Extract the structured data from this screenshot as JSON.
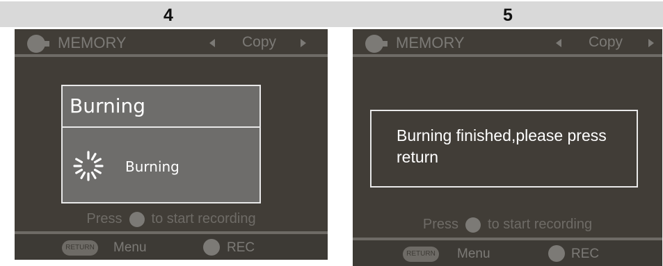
{
  "steps": {
    "left": "4",
    "right": "5"
  },
  "screen4": {
    "header": {
      "title": "MEMORY",
      "option": "Copy"
    },
    "dialog": {
      "title": "Burning",
      "status": "Burning"
    },
    "hint": {
      "press": "Press",
      "rest": "to start recording"
    },
    "footer": {
      "return_label": "RETURN",
      "menu": "Menu",
      "rec": "REC"
    }
  },
  "screen5": {
    "header": {
      "title": "MEMORY",
      "option": "Copy"
    },
    "message": "Burning finished,please press return",
    "hint": {
      "press": "Press",
      "rest": "to start recording"
    },
    "footer": {
      "return_label": "RETURN",
      "menu": "Menu",
      "rec": "REC"
    }
  },
  "colors": {
    "screen_bg": "#413d37",
    "dim_text": "#7c7a76",
    "dialog_bg": "#6e6d6b"
  }
}
